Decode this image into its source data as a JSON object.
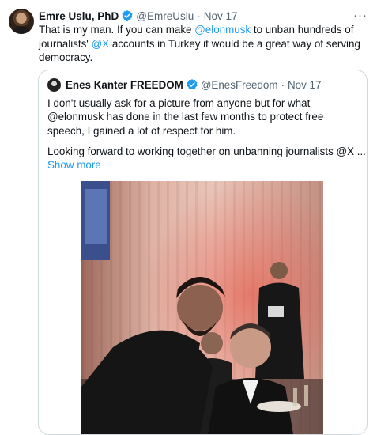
{
  "tweet": {
    "author_name": "Emre Uslu, PhD",
    "author_handle": "@EmreUslu",
    "separator": "·",
    "date": "Nov 17",
    "more_label": "···",
    "text_part1": "That is my man. If you can make ",
    "mention_elon": "@elonmusk",
    "text_part2": " to unban hundreds of journalists' ",
    "mention_x": "@X",
    "text_part3": " accounts in Turkey it would be a great way of serving democracy."
  },
  "quote": {
    "author_name": "Enes Kanter FREEDOM",
    "author_handle": "@EnesFreedom",
    "separator": "·",
    "date": "Nov 17",
    "paragraph1": "I don't usually ask for a picture from anyone but for what @elonmusk has done in the last few months to protect free speech, I gained a lot of respect for him.",
    "paragraph2": "Looking forward to working together on unbanning journalists @X ...",
    "show_more": "Show more"
  },
  "colors": {
    "link": "#1d9bf0",
    "verified": "#1d9bf0",
    "secondary_text": "#536471",
    "border": "#cfd9de"
  },
  "icons": {
    "verified": "verified-badge-icon",
    "more": "more-options-icon"
  }
}
